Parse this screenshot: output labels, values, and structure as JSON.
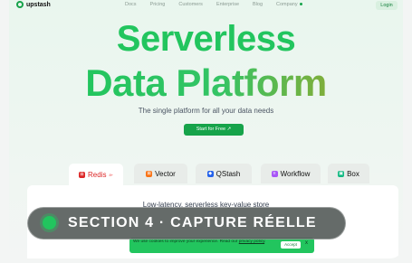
{
  "header": {
    "logo_text": "upstash",
    "nav": [
      "Docs",
      "Pricing",
      "Customers",
      "Enterprise",
      "Blog",
      "Company"
    ],
    "login_label": "Login"
  },
  "hero": {
    "line1": "Serverless",
    "line2": "Data Platform",
    "subtitle": "The single platform for all your data needs",
    "cta_label": "Start for Free ↗"
  },
  "tabs": [
    {
      "label": "Redis",
      "badge": "8+",
      "icon": "redis-icon",
      "color": "#dc2626"
    },
    {
      "label": "Vector",
      "icon": "vector-icon",
      "color": "#f97316"
    },
    {
      "label": "QStash",
      "icon": "qstash-icon",
      "color": "#2563eb"
    },
    {
      "label": "Workflow",
      "icon": "workflow-icon",
      "color": "#a855f7"
    },
    {
      "label": "Box",
      "icon": "box-icon",
      "color": "#10b981"
    }
  ],
  "panel": {
    "text": "Low-latency, serverless key-value store"
  },
  "overlay": {
    "label": "SECTION 4 · CAPTURE RÉELLE"
  },
  "cookie": {
    "text": "We use cookies to improve your experience. Read our",
    "link": "privacy policy",
    "accept_label": "Accept",
    "close_label": "x"
  },
  "colors": {
    "accent": "#22c55e",
    "accent_dark": "#16a34a"
  }
}
